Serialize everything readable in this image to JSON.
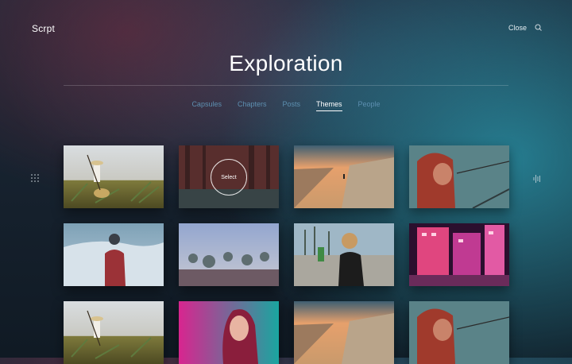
{
  "header": {
    "logo": "Scrpt",
    "close_label": "Close",
    "search_icon": "search-icon"
  },
  "main": {
    "title": "Exploration",
    "tabs": [
      {
        "label": "Capsules",
        "active": false
      },
      {
        "label": "Chapters",
        "active": false
      },
      {
        "label": "Posts",
        "active": false
      },
      {
        "label": "Themes",
        "active": true
      },
      {
        "label": "People",
        "active": false
      }
    ],
    "hover_label": "Select"
  },
  "side": {
    "left_icon": "grid-dots-icon",
    "right_icon": "vertical-bars-icon"
  },
  "colors": {
    "tab_inactive": "#5d8fb0",
    "tab_active": "#ffffff"
  }
}
